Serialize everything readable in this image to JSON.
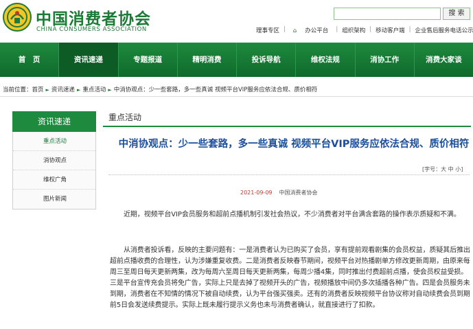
{
  "header": {
    "brand_cn": "中国消费者协会",
    "brand_en": "CHINA CONSUMERS ASSOCIATION",
    "search_button": "搜 索",
    "top_links": [
      {
        "label": "理事专区"
      },
      {
        "label": "办公平台"
      },
      {
        "label": "组织架构"
      },
      {
        "label": "移动客户端"
      },
      {
        "label": "企业售后服务电话公示"
      }
    ]
  },
  "nav": [
    {
      "label": "首　页"
    },
    {
      "label": "资讯速递"
    },
    {
      "label": "专题报道"
    },
    {
      "label": "精明消费"
    },
    {
      "label": "投诉导航"
    },
    {
      "label": "维权法规"
    },
    {
      "label": "消协工作"
    },
    {
      "label": "消费大家谈"
    }
  ],
  "breadcrumb": {
    "prefix": "当前位置：",
    "items": [
      "首页",
      "资讯速递",
      "重点活动",
      "中消协观点：少一些套路，多一些真诚 视频平台VIP服务应依法合规、质价相符"
    ]
  },
  "sidebar": {
    "title": "资讯速递",
    "items": [
      {
        "label": "重点活动"
      },
      {
        "label": "消协观点"
      },
      {
        "label": "维权广角"
      },
      {
        "label": "图片新闻"
      }
    ]
  },
  "main": {
    "section_title": "重点活动",
    "article_title": "中消协观点：少一些套路，多一些真诚 视频平台VIP服务应依法合规、质价相符",
    "font_control": "[字号：大 中 小]",
    "date": "2021-09-09",
    "source": "中国消费者协会",
    "paragraphs": [
      "近期，视频平台VIP会员服务和超前点播机制引发社会热议，不少消费者对平台满含套路的操作表示质疑和不满。",
      "从消费者投诉看，反映的主要问题有：一是消费者认为已购买了会员，享有提前观看剧集的会员权益，质疑其后推出超前点播收费的合理性，认为涉嫌重复收费。二是消费者反映春节期间，视频平台对热播剧单方修改更新周期，由原来每周三至周日每天更新两集，改为每周六至周日每天更新两集，每周少播4集，同时推出付费超前点播，使会员权益受损。三是平台宣传充会员将免广告，实际上只是去掉了视频开头的广告，视频播放中间仍多次插播各种广告。四是会员服务未到期，消费者在不知情的情况下被自动续费，认为平台强买强卖。还有的消费者反映视频平台协议称对自动续费会员到期前5日会发送续费提示。实际上既未履行提示义务也未与消费者确认，就直接进行了扣款。"
    ]
  },
  "colors": {
    "brand_green": "#1b7a35",
    "nav_green": "#1e8a3e",
    "title_blue": "#1b4f9c",
    "date_red": "#c0392b"
  }
}
